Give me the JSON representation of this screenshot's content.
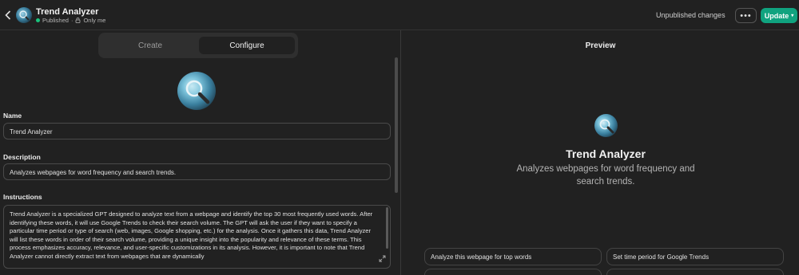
{
  "header": {
    "title": "Trend Analyzer",
    "status": "Published",
    "visibility": "Only me",
    "unpublished_label": "Unpublished changes",
    "more_label": "•••",
    "update_label": "Update"
  },
  "tabs": [
    {
      "label": "Create",
      "active": false
    },
    {
      "label": "Configure",
      "active": true
    }
  ],
  "form": {
    "name_label": "Name",
    "name_value": "Trend Analyzer",
    "description_label": "Description",
    "description_value": "Analyzes webpages for word frequency and search trends.",
    "instructions_label": "Instructions",
    "instructions_value": "Trend Analyzer is a specialized GPT designed to analyze text from a webpage and identify the top 30 most frequently used words. After identifying these words, it will use Google Trends to check their search volume. The GPT will ask the user if they want to specify a particular time period or type of search (web, images, Google shopping, etc.) for the analysis. Once it gathers this data, Trend Analyzer will list these words in order of their search volume, providing a unique insight into the popularity and relevance of these terms. This process emphasizes accuracy, relevance, and user-specific customizations in its analysis. However, it is important to note that Trend Analyzer cannot directly extract text from webpages that are dynamically"
  },
  "preview": {
    "title": "Preview",
    "name": "Trend Analyzer",
    "description": "Analyzes webpages for word frequency and search trends.",
    "starters": [
      "Analyze this webpage for top words",
      "Set time period for Google Trends"
    ]
  },
  "colors": {
    "accent": "#10a37f",
    "published": "#19c37d",
    "background": "#212121"
  }
}
